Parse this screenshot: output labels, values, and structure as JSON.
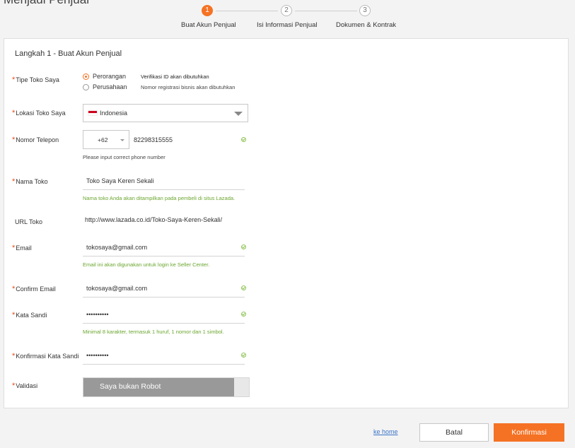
{
  "page": {
    "title": "Menjadi Penjual"
  },
  "stepper": {
    "steps": [
      {
        "number": "1",
        "label": "Buat Akun Penjual",
        "active": true
      },
      {
        "number": "2",
        "label": "Isi Informasi Penjual",
        "active": false
      },
      {
        "number": "3",
        "label": "Dokumen & Kontrak",
        "active": false
      }
    ]
  },
  "form": {
    "section_title": "Langkah 1 - Buat Akun Penjual",
    "required_mark": "*",
    "store_type": {
      "label": "Tipe Toko Saya",
      "options": [
        {
          "label": "Perorangan",
          "description": "Verifikasi ID akan dibutuhkan",
          "selected": true
        },
        {
          "label": "Perusahaan",
          "description": "Nomor registrasi bisnis akan dibutuhkan",
          "selected": false
        }
      ]
    },
    "location": {
      "label": "Lokasi Toko Saya",
      "value": "Indonesia"
    },
    "phone": {
      "label": "Nomor Telepon",
      "country_code": "+62",
      "number": "82298315555",
      "hint": "Please input correct phone number"
    },
    "store_name": {
      "label": "Nama Toko",
      "value": "Toko Saya Keren Sekali",
      "hint": "Nama toko Anda akan ditampilkan pada pembeli di situs Lazada."
    },
    "store_url": {
      "label": "URL Toko",
      "value": "http://www.lazada.co.id/Toko-Saya-Keren-Sekali/"
    },
    "email": {
      "label": "Email",
      "value": "tokosaya@gmail.com",
      "hint": "Email ini akan digunakan untuk login ke Seller Center."
    },
    "confirm_email": {
      "label": "Confirm Email",
      "value": "tokosaya@gmail.com"
    },
    "password": {
      "label": "Kata Sandi",
      "value": "••••••••••",
      "hint": "Minimal 8 karakter, termasuk 1 huruf, 1 nomor dan 1 simbol."
    },
    "confirm_password": {
      "label": "Konfirmasi Kata Sandi",
      "value": "••••••••••"
    },
    "validation": {
      "label": "Validasi",
      "slider_text": "Saya bukan Robot",
      "progress": 0.91
    }
  },
  "footer": {
    "link_home": "ke home",
    "cancel_label": "Batal",
    "confirm_label": "Konfirmasi"
  },
  "colors": {
    "accent": "#f57224",
    "success": "#8fc455",
    "link": "#3a73c8",
    "required": "#e64b1c"
  }
}
